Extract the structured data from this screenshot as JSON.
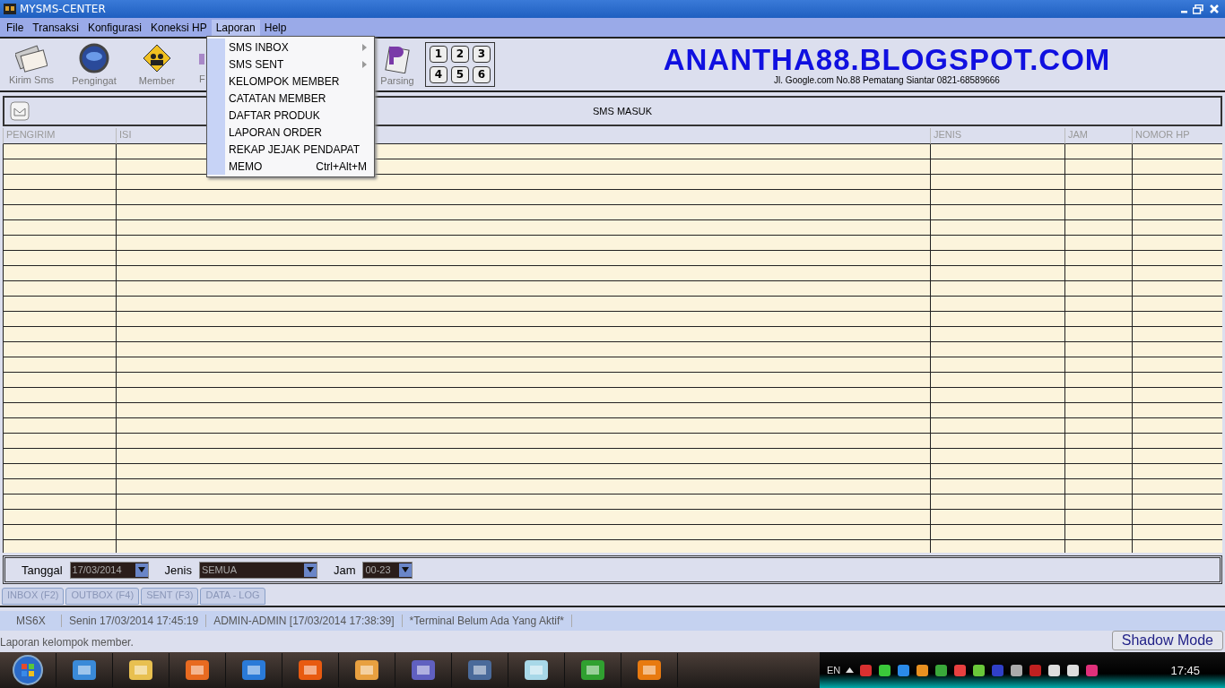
{
  "window": {
    "title": "MYSMS-CENTER"
  },
  "menu_bar": [
    {
      "label": "File",
      "open": false
    },
    {
      "label": "Transaksi",
      "open": false
    },
    {
      "label": "Konfigurasi",
      "open": false
    },
    {
      "label": "Koneksi HP",
      "open": false
    },
    {
      "label": "Laporan",
      "open": true
    },
    {
      "label": "Help",
      "open": false
    }
  ],
  "open_menu": {
    "items": [
      {
        "label": "SMS INBOX",
        "submenu": true
      },
      {
        "label": "SMS SENT",
        "submenu": true
      },
      {
        "label": "KELOMPOK MEMBER",
        "submenu": false
      },
      {
        "label": "CATATAN MEMBER",
        "submenu": false
      },
      {
        "label": "DAFTAR PRODUK",
        "submenu": false
      },
      {
        "label": "LAPORAN ORDER",
        "submenu": false
      },
      {
        "label": "REKAP JEJAK PENDAPAT",
        "submenu": false
      },
      {
        "label": "MEMO",
        "shortcut": "Ctrl+Alt+M",
        "submenu": false
      }
    ]
  },
  "toolbar": [
    {
      "label": "Kirim Sms",
      "kind": "mail"
    },
    {
      "label": "Pengingat",
      "kind": "globe"
    },
    {
      "label": "Member",
      "kind": "people"
    },
    {
      "label": "F",
      "kind": "cut"
    },
    {
      "label": "Parsing",
      "kind": "doc"
    }
  ],
  "keypad": [
    "1",
    "2",
    "3",
    "4",
    "5",
    "6"
  ],
  "banner": {
    "title": "ANANTHA88.BLOGSPOT.COM",
    "subtitle": "Jl. Google.com No.88 Pematang Siantar 0821-68589666"
  },
  "panel_title": "SMS MASUK",
  "table": {
    "columns": [
      "PENGIRIM",
      "ISI",
      "JENIS",
      "JAM",
      "NOMOR HP"
    ]
  },
  "filters": [
    {
      "label": "Tanggal",
      "value": "17/03/2014"
    },
    {
      "label": "Jenis",
      "value": "SEMUA"
    },
    {
      "label": "Jam",
      "value": "00-23"
    }
  ],
  "tabs": [
    "INBOX (F2)",
    "OUTBOX (F4)",
    "SENT (F3)",
    "DATA - LOG"
  ],
  "status_bar": [
    "MS6X",
    "Senin 17/03/2014 17:45:19",
    "ADMIN-ADMIN [17/03/2014 17:38:39]",
    "*Terminal Belum Ada Yang Aktif*"
  ],
  "hint": "Laporan kelompok member.",
  "shadow_button": "Shadow Mode",
  "taskbar": {
    "language": "EN",
    "clock": "17:45"
  }
}
